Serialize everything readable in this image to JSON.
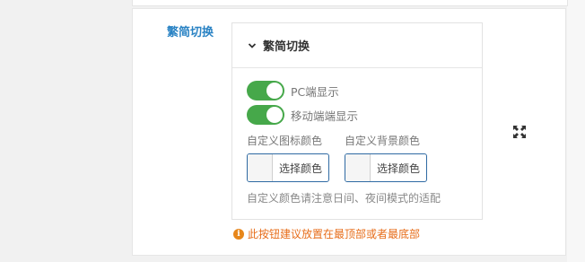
{
  "field": {
    "label": "繁简切换"
  },
  "panel": {
    "title": "繁简切换",
    "toggles": [
      {
        "label": "PC端显示",
        "on": true
      },
      {
        "label": "移动端端显示",
        "on": true
      }
    ],
    "colors": [
      {
        "label": "自定义图标颜色",
        "button": "选择颜色"
      },
      {
        "label": "自定义背景颜色",
        "button": "选择颜色"
      }
    ],
    "note": "自定义颜色请注意日间、夜间模式的适配"
  },
  "warning": {
    "text": "此按钮建议放置在最顶部或者最底部",
    "icon": "info-icon"
  },
  "icons": {
    "collapse": "chevron-down-icon",
    "expand": "expand-arrows-icon"
  },
  "theme": {
    "accent": "#2a83c4",
    "toggle_on": "#46a84a",
    "warning": "#e76d1a"
  }
}
